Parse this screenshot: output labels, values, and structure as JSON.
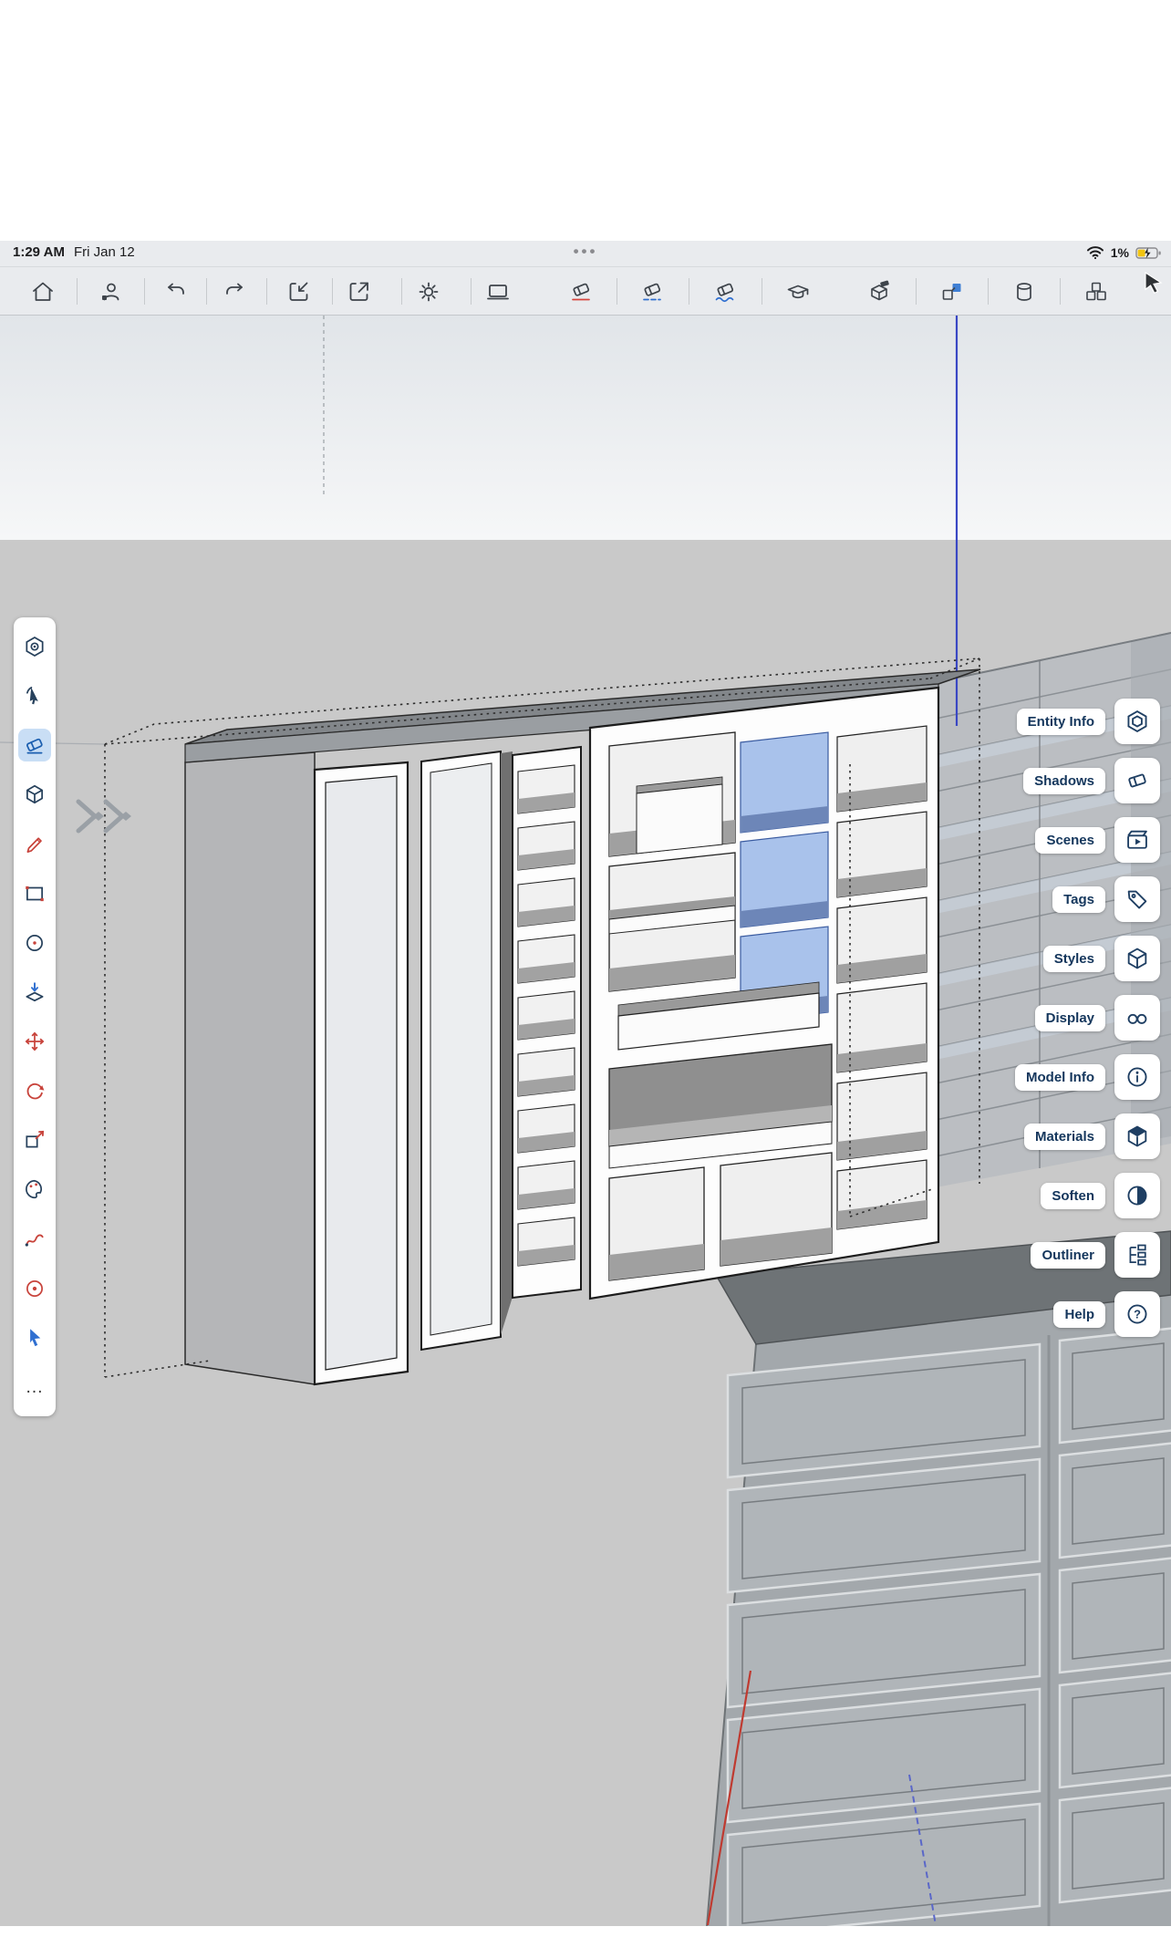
{
  "status_bar": {
    "time": "1:29 AM",
    "date": "Fri Jan 12",
    "overflow_dots": "•••",
    "battery_percent": "1%",
    "battery_charging": true,
    "wifi_icon": "wifi-icon",
    "battery_icon": "battery-icon"
  },
  "toolbar": {
    "left_icons": [
      "home-icon",
      "account-icon",
      "undo-icon",
      "redo-icon",
      "import-model-icon",
      "export-icon",
      "settings-icon",
      "device-icon"
    ],
    "center_icons": [
      "eraser-erase-icon",
      "eraser-hide-icon",
      "eraser-soften-icon",
      "soften-cap-icon"
    ],
    "right_icons": [
      "solid-tools-icon",
      "components-icon",
      "cylinder-tool-icon",
      "primitives-icon"
    ]
  },
  "left_toolbar": {
    "selected_tool": "eraser",
    "tools": [
      "autoshape",
      "select",
      "eraser",
      "box",
      "pencil",
      "rectangle",
      "circle",
      "push-pull",
      "move",
      "rotate",
      "scale",
      "paint",
      "freehand",
      "offset",
      "cursor",
      "more"
    ],
    "more_label": "…"
  },
  "right_panel": {
    "items": [
      {
        "label": "Entity Info",
        "icon": "entity-info-icon"
      },
      {
        "label": "Shadows",
        "icon": "shadows-icon"
      },
      {
        "label": "Scenes",
        "icon": "scenes-icon"
      },
      {
        "label": "Tags",
        "icon": "tags-icon"
      },
      {
        "label": "Styles",
        "icon": "styles-icon"
      },
      {
        "label": "Display",
        "icon": "display-icon"
      },
      {
        "label": "Model Info",
        "icon": "model-info-icon"
      },
      {
        "label": "Materials",
        "icon": "materials-icon"
      },
      {
        "label": "Soften",
        "icon": "soften-icon"
      },
      {
        "label": "Outliner",
        "icon": "outliner-icon"
      },
      {
        "label": "Help",
        "icon": "help-icon"
      }
    ]
  },
  "colors": {
    "selection_blue": "#9db9e8",
    "axis_blue": "#3947c4",
    "axis_red": "#bf3a30",
    "ground_gray": "#c9c9c9",
    "toolbar_bg": "#e9ebee",
    "accent_navy": "#14365c"
  }
}
